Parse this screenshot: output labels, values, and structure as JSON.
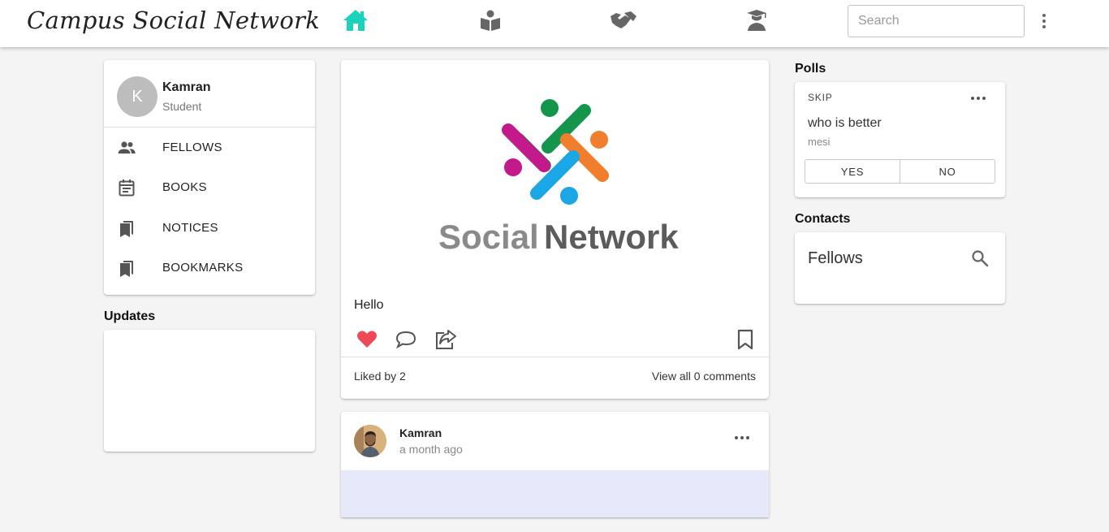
{
  "header": {
    "brand": "Campus Social Network",
    "search_placeholder": "Search",
    "nav": [
      {
        "name": "home-icon",
        "active": true
      },
      {
        "name": "book-reader-icon",
        "active": false
      },
      {
        "name": "handshake-icon",
        "active": false
      },
      {
        "name": "graduate-icon",
        "active": false
      }
    ],
    "accent_color": "#1bd3bd"
  },
  "profile": {
    "initial": "K",
    "name": "Kamran",
    "role": "Student"
  },
  "menu": [
    {
      "label": "FELLOWS",
      "icon": "people-icon"
    },
    {
      "label": "BOOKS",
      "icon": "calendar-note-icon"
    },
    {
      "label": "NOTICES",
      "icon": "bookmarks-icon"
    },
    {
      "label": "BOOKMARKS",
      "icon": "bookmarks-icon"
    }
  ],
  "updates": {
    "title": "Updates"
  },
  "post": {
    "logo_text_part1": "Social",
    "logo_text_part2": "Network",
    "caption": "Hello",
    "liked_by": "Liked by 2",
    "view_comments": "View all 0 comments",
    "liked": true
  },
  "post2": {
    "author": "Kamran",
    "time": "a month ago"
  },
  "polls": {
    "title": "Polls",
    "skip_label": "SKIP",
    "question": "who is better",
    "subtext": "mesi",
    "yes_label": "YES",
    "no_label": "NO"
  },
  "contacts": {
    "title": "Contacts",
    "card_title": "Fellows"
  }
}
